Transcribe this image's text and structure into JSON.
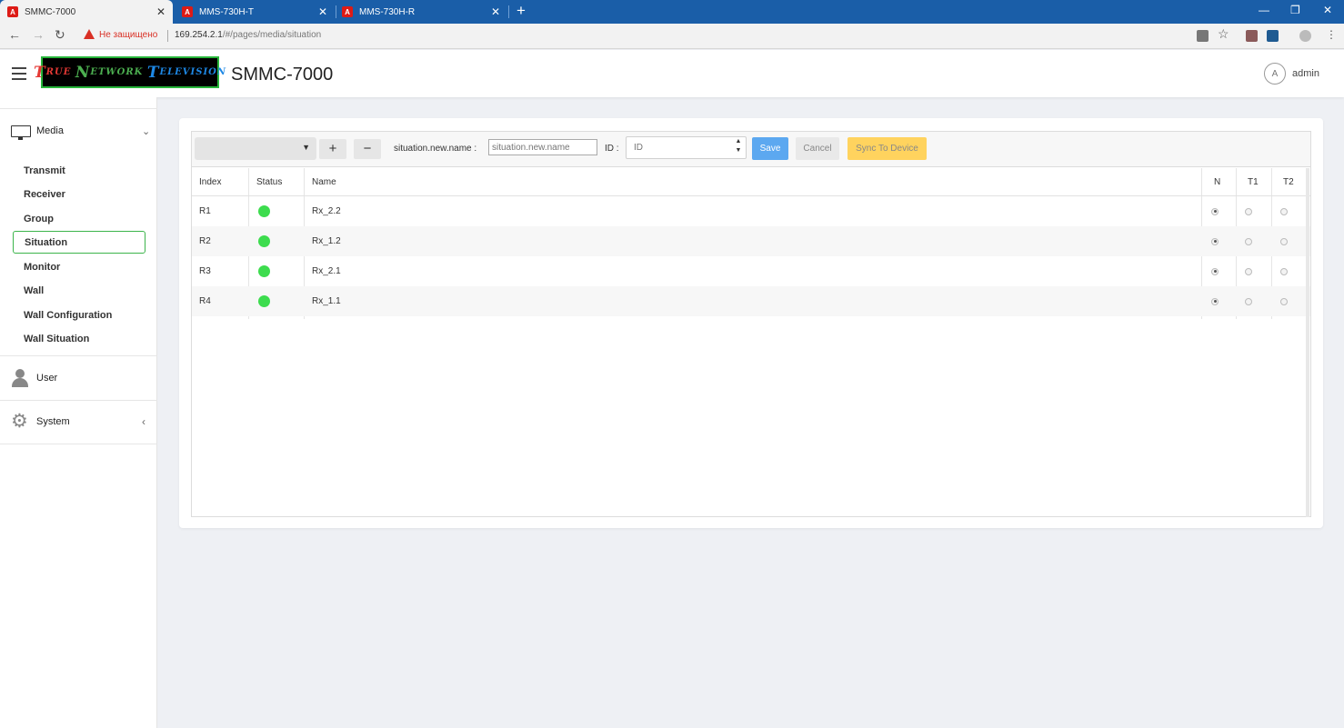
{
  "browser": {
    "tabs": [
      {
        "title": "SMMC-7000",
        "icon": "angular-icon"
      },
      {
        "title": "MMS-730H-T",
        "icon": "angular-icon"
      },
      {
        "title": "MMS-730H-R",
        "icon": "angular-icon"
      }
    ],
    "security_warning": "Не защищено",
    "url_host": "169.254.2.1",
    "url_path": "/#/pages/media/situation"
  },
  "header": {
    "app_title": "SMMC-7000",
    "logo": "True Network Television",
    "avatar_letter": "A",
    "user": "admin"
  },
  "sidebar": {
    "media_label": "Media",
    "items": [
      {
        "label": "Transmit"
      },
      {
        "label": "Receiver"
      },
      {
        "label": "Group"
      },
      {
        "label": "Situation",
        "active": true
      },
      {
        "label": "Monitor"
      },
      {
        "label": "Wall"
      },
      {
        "label": "Wall Configuration"
      },
      {
        "label": "Wall Situation"
      }
    ],
    "user_label": "User",
    "system_label": "System"
  },
  "toolbar": {
    "dropdown_value": "",
    "name_label": "situation.new.name :",
    "name_placeholder": "situation.new.name",
    "id_label": "ID :",
    "id_placeholder": "ID",
    "save_label": "Save",
    "cancel_label": "Cancel",
    "sync_label": "Sync To Device"
  },
  "table": {
    "columns": [
      "Index",
      "Status",
      "Name",
      "N",
      "T1",
      "T2"
    ],
    "rows": [
      {
        "index": "R1",
        "status": "online",
        "name": "Rx_2.2",
        "selected": "N"
      },
      {
        "index": "R2",
        "status": "online",
        "name": "Rx_1.2",
        "selected": "N"
      },
      {
        "index": "R3",
        "status": "online",
        "name": "Rx_2.1",
        "selected": "N"
      },
      {
        "index": "R4",
        "status": "online",
        "name": "Rx_1.1",
        "selected": "N"
      }
    ]
  },
  "colors": {
    "accent_blue": "#5ca8f0",
    "sync_yellow": "#ffd35e",
    "status_green": "#3ddc4e",
    "active_border": "#3cb44b"
  }
}
